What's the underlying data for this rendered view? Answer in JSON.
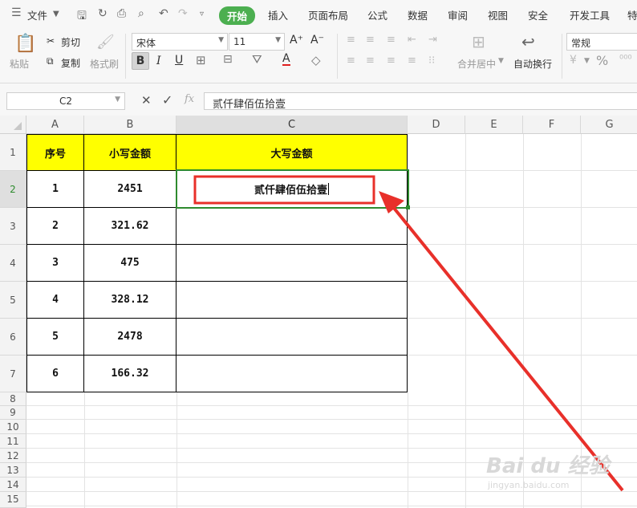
{
  "menubar": {
    "file_label": "文件",
    "tabs": [
      "开始",
      "插入",
      "页面布局",
      "公式",
      "数据",
      "审阅",
      "视图",
      "安全",
      "开发工具",
      "特"
    ]
  },
  "ribbon": {
    "paste": "粘贴",
    "cut": "剪切",
    "copy": "复制",
    "format_painter": "格式刷",
    "font_name": "宋体",
    "font_size": "11",
    "bold": "B",
    "italic": "I",
    "underline": "U",
    "increase_font": "A⁺",
    "decrease_font": "A⁻",
    "merge_center": "合并居中",
    "wrap_text": "自动换行",
    "number_format": "常规",
    "percent": "%"
  },
  "formula_bar": {
    "name_box": "C2",
    "cancel": "✕",
    "confirm": "✓",
    "fx": "fx",
    "content": "贰仟肆佰伍拾壹"
  },
  "sheet": {
    "columns": [
      "A",
      "B",
      "C",
      "D",
      "E",
      "F",
      "G"
    ],
    "rows": [
      "1",
      "2",
      "3",
      "4",
      "5",
      "6",
      "7",
      "8",
      "9",
      "10",
      "11",
      "12",
      "13",
      "14",
      "15"
    ],
    "selected_cell": "C2",
    "headers": [
      "序号",
      "小写金额",
      "大写金额"
    ],
    "data": [
      {
        "a": "1",
        "b": "2451",
        "c": "贰仟肆佰伍拾壹"
      },
      {
        "a": "2",
        "b": "321.62",
        "c": ""
      },
      {
        "a": "3",
        "b": "475",
        "c": ""
      },
      {
        "a": "4",
        "b": "328.12",
        "c": ""
      },
      {
        "a": "5",
        "b": "2478",
        "c": ""
      },
      {
        "a": "6",
        "b": "166.32",
        "c": ""
      }
    ]
  },
  "colors": {
    "header_fill": "#ffff00",
    "active_tab": "#4caf50",
    "selection": "#2e8b2e",
    "annotation": "#e8302a"
  },
  "watermark": {
    "brand": "Bai du 经验",
    "url": "jingyan.baidu.com"
  }
}
